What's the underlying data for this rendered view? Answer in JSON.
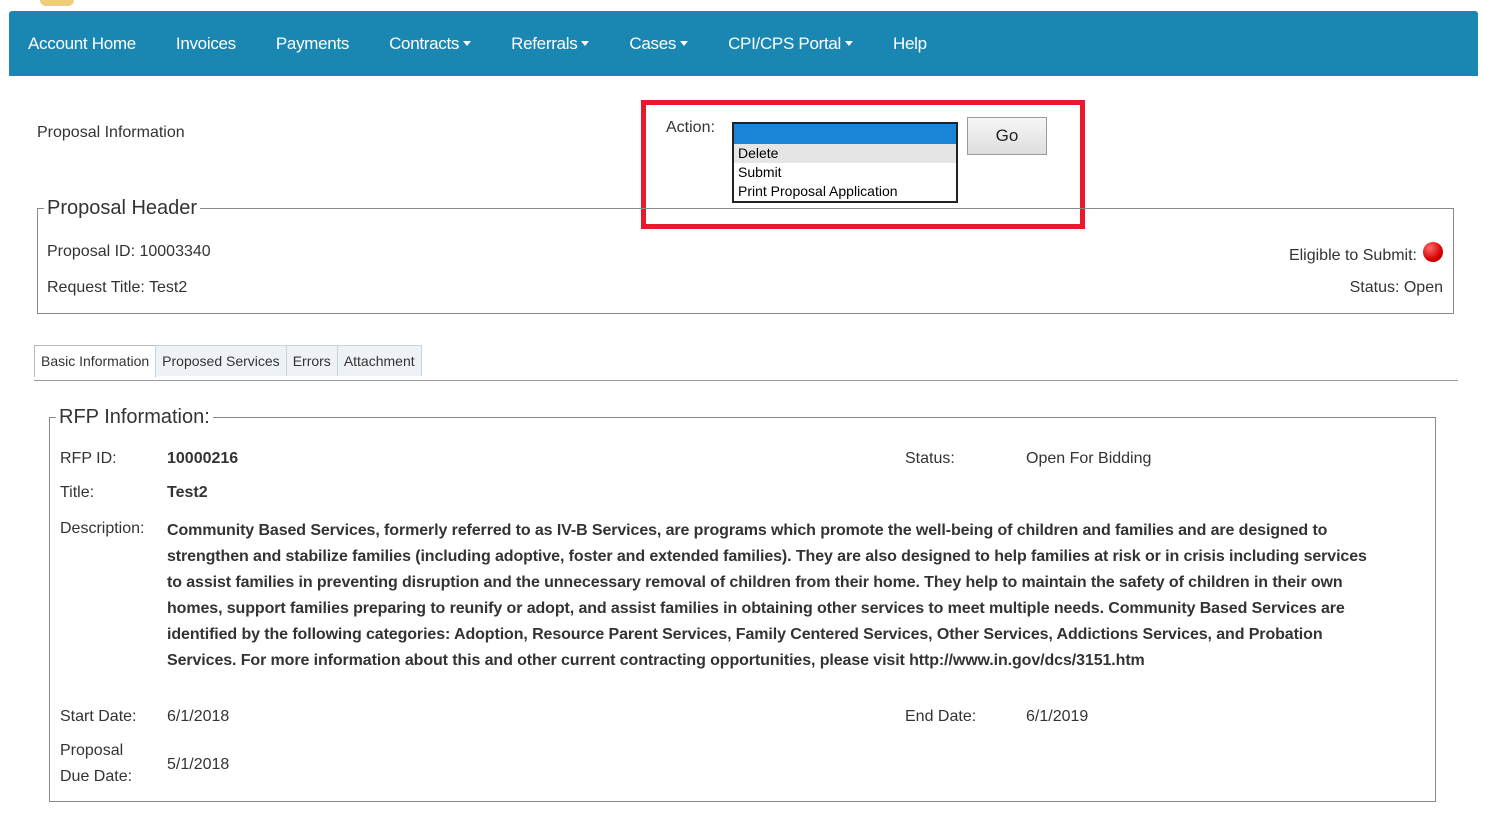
{
  "nav": {
    "items": [
      {
        "label": "Account Home",
        "dropdown": false
      },
      {
        "label": "Invoices",
        "dropdown": false
      },
      {
        "label": "Payments",
        "dropdown": false
      },
      {
        "label": "Contracts",
        "dropdown": true
      },
      {
        "label": "Referrals",
        "dropdown": true
      },
      {
        "label": "Cases",
        "dropdown": true
      },
      {
        "label": "CPI/CPS Portal",
        "dropdown": true
      },
      {
        "label": "Help",
        "dropdown": false
      }
    ]
  },
  "page": {
    "title": "Proposal Information"
  },
  "action": {
    "label": "Action:",
    "selected": "",
    "options": [
      "Delete",
      "Submit",
      "Print Proposal Application"
    ],
    "go_label": "Go"
  },
  "header": {
    "legend": "Proposal Header",
    "proposal_id": "Proposal ID: 10003340",
    "request_title": "Request Title: Test2",
    "eligible_label": "Eligible to Submit:",
    "status": "Status: Open"
  },
  "tabs": [
    "Basic Information",
    "Proposed Services",
    "Errors",
    "Attachment"
  ],
  "rfp": {
    "legend": "RFP Information:",
    "id_label": "RFP ID:",
    "id_value": "10000216",
    "status_label": "Status:",
    "status_value": "Open For Bidding",
    "title_label": "Title:",
    "title_value": "Test2",
    "description_label": "Description:",
    "description_value": "Community Based Services, formerly referred to as IV-B Services, are programs which promote the well-being of children and families and are designed to strengthen and stabilize families (including adoptive, foster and extended families). They are also designed to help families at risk or in crisis including services to assist families in preventing disruption and the unnecessary removal of children from their home. They help to maintain the safety of children in their own homes, support families preparing to reunify or adopt, and assist families in obtaining other services to meet multiple needs. Community Based Services are identified by the following categories: Adoption, Resource Parent Services, Family Centered Services, Other Services, Addictions Services, and Probation Services. For more information about this and other current contracting opportunities, please visit http://www.in.gov/dcs/3151.htm",
    "start_label": "Start Date:",
    "start_value": "6/1/2018",
    "end_label": "End Date:",
    "end_value": "6/1/2019",
    "due_label_1": "Proposal",
    "due_label_2": "Due Date:",
    "due_value": "5/1/2018"
  },
  "colors": {
    "nav_bg": "#1a86b2",
    "highlight_box": "#e8192c",
    "select_highlight": "#1a84d6",
    "status_dot": "#d60000"
  }
}
